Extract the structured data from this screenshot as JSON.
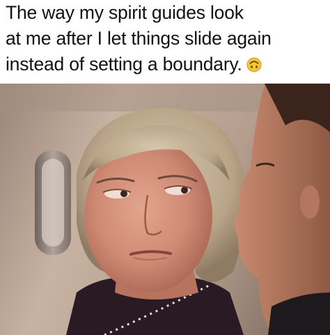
{
  "caption": {
    "line1": "The way my spirit guides look",
    "line2": "at me after I let things slide again",
    "line3": "instead of setting a boundary."
  },
  "icons": {
    "emoji": "upside-down-smiling-face-icon"
  },
  "colors": {
    "caption_text": "#121212",
    "background": "#ffffff",
    "emoji_fill": "#f5c33b"
  }
}
